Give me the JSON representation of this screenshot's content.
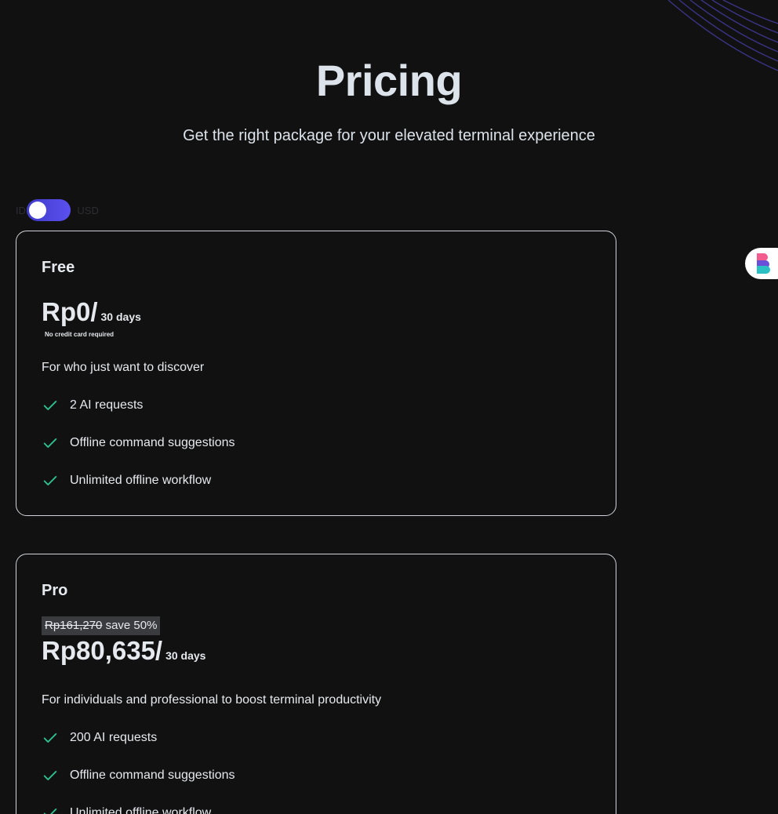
{
  "header": {
    "title": "Pricing",
    "subtitle": "Get the right package for your elevated terminal experience"
  },
  "currency_toggle": {
    "left_label": "IDR",
    "right_label": "USD",
    "selected": "IDR"
  },
  "plans": [
    {
      "name": "Free",
      "price": "Rp0/",
      "period": "30 days",
      "note": "No credit card required",
      "description": "For who just want to discover",
      "features": [
        "2 AI requests",
        "Offline command suggestions",
        "Unlimited offline workflow"
      ]
    },
    {
      "name": "Pro",
      "original_price": "Rp161,270",
      "discount": "save 50%",
      "price": "Rp80,635/",
      "period": "30 days",
      "description": "For individuals and professional to boost terminal productivity",
      "features": [
        "200 AI requests",
        "Offline command suggestions",
        "Unlimited offline workflow"
      ]
    }
  ],
  "colors": {
    "background": "#111111",
    "accent": "#5b50f0",
    "check": "#2fbf8f"
  },
  "icons": {
    "check": "check-icon",
    "widget": "brand-logo-icon"
  }
}
